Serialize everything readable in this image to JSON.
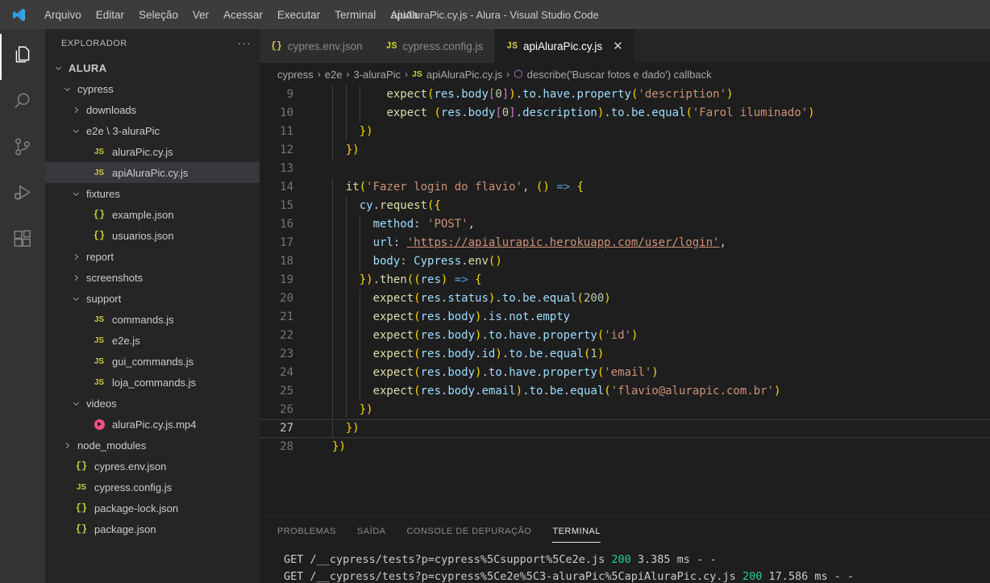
{
  "window": {
    "title": "apiAluraPic.cy.js - Alura - Visual Studio Code",
    "logo_icon": "vscode-logo-icon"
  },
  "menu": {
    "items": [
      {
        "label": "Arquivo"
      },
      {
        "label": "Editar"
      },
      {
        "label": "Seleção"
      },
      {
        "label": "Ver"
      },
      {
        "label": "Acessar"
      },
      {
        "label": "Executar"
      },
      {
        "label": "Terminal"
      },
      {
        "label": "Ajuda"
      }
    ]
  },
  "activitybar": {
    "items": [
      {
        "name": "explorer",
        "icon": "files-icon",
        "active": true
      },
      {
        "name": "search",
        "icon": "search-icon",
        "active": false
      },
      {
        "name": "source-control",
        "icon": "source-control-icon",
        "active": false
      },
      {
        "name": "run-and-debug",
        "icon": "run-debug-icon",
        "active": false
      },
      {
        "name": "extensions",
        "icon": "extensions-icon",
        "active": false
      }
    ]
  },
  "sidebar": {
    "header": {
      "title": "EXPLORADOR",
      "more_icon": "ellipsis-icon"
    },
    "items": [
      {
        "label": "ALURA",
        "kind": "root",
        "indent": 0,
        "expanded": true,
        "selected": false
      },
      {
        "label": "cypress",
        "kind": "folder",
        "indent": 1,
        "expanded": true,
        "selected": false
      },
      {
        "label": "downloads",
        "kind": "folder",
        "indent": 2,
        "expanded": false,
        "selected": false
      },
      {
        "label": "e2e \\ 3-aluraPic",
        "kind": "folder",
        "indent": 2,
        "expanded": true,
        "selected": false
      },
      {
        "label": "aluraPic.cy.js",
        "kind": "js",
        "indent": 3,
        "selected": false
      },
      {
        "label": "apiAluraPic.cy.js",
        "kind": "js",
        "indent": 3,
        "selected": true
      },
      {
        "label": "fixtures",
        "kind": "folder",
        "indent": 2,
        "expanded": true,
        "selected": false
      },
      {
        "label": "example.json",
        "kind": "json",
        "indent": 3,
        "selected": false
      },
      {
        "label": "usuarios.json",
        "kind": "json",
        "indent": 3,
        "selected": false
      },
      {
        "label": "report",
        "kind": "folder",
        "indent": 2,
        "expanded": false,
        "selected": false
      },
      {
        "label": "screenshots",
        "kind": "folder",
        "indent": 2,
        "expanded": false,
        "selected": false
      },
      {
        "label": "support",
        "kind": "folder",
        "indent": 2,
        "expanded": true,
        "selected": false
      },
      {
        "label": "commands.js",
        "kind": "js",
        "indent": 3,
        "selected": false
      },
      {
        "label": "e2e.js",
        "kind": "js",
        "indent": 3,
        "selected": false
      },
      {
        "label": "gui_commands.js",
        "kind": "js",
        "indent": 3,
        "selected": false
      },
      {
        "label": "loja_commands.js",
        "kind": "js",
        "indent": 3,
        "selected": false
      },
      {
        "label": "videos",
        "kind": "folder",
        "indent": 2,
        "expanded": true,
        "selected": false
      },
      {
        "label": "aluraPic.cy.js.mp4",
        "kind": "mp4",
        "indent": 3,
        "selected": false
      },
      {
        "label": "node_modules",
        "kind": "folder",
        "indent": 1,
        "expanded": false,
        "selected": false
      },
      {
        "label": "cypres.env.json",
        "kind": "json",
        "indent": 1,
        "selected": false
      },
      {
        "label": "cypress.config.js",
        "kind": "js",
        "indent": 1,
        "selected": false
      },
      {
        "label": "package-lock.json",
        "kind": "json",
        "indent": 1,
        "selected": false
      },
      {
        "label": "package.json",
        "kind": "json",
        "indent": 1,
        "selected": false
      }
    ]
  },
  "tabs": [
    {
      "label": "cypres.env.json",
      "icon": "json-file-icon",
      "icon_glyph": "{}",
      "active": false,
      "closeable": false
    },
    {
      "label": "cypress.config.js",
      "icon": "js-file-icon",
      "icon_glyph": "JS",
      "active": false,
      "closeable": false
    },
    {
      "label": "apiAluraPic.cy.js",
      "icon": "js-file-icon",
      "icon_glyph": "JS",
      "active": true,
      "closeable": true,
      "close_glyph": "✕"
    }
  ],
  "breadcrumb": {
    "segments": [
      "cypress",
      "e2e",
      "3-aluraPic",
      "apiAluraPic.cy.js",
      "describe('Buscar fotos e dado') callback"
    ],
    "separator": "›",
    "js_glyph": "JS",
    "symbol_glyph": "⬡"
  },
  "editor": {
    "current_line": 27,
    "lines": [
      {
        "n": 9,
        "indent_guides": [
          1,
          2,
          3
        ]
      },
      {
        "n": 10,
        "indent_guides": [
          1,
          2,
          3
        ]
      },
      {
        "n": 11,
        "indent_guides": [
          1,
          2
        ]
      },
      {
        "n": 12,
        "indent_guides": [
          1
        ]
      },
      {
        "n": 13,
        "indent_guides": [
          1
        ]
      },
      {
        "n": 14,
        "indent_guides": [
          1
        ]
      },
      {
        "n": 15,
        "indent_guides": [
          1,
          2
        ]
      },
      {
        "n": 16,
        "indent_guides": [
          1,
          2,
          3
        ]
      },
      {
        "n": 17,
        "indent_guides": [
          1,
          2,
          3
        ]
      },
      {
        "n": 18,
        "indent_guides": [
          1,
          2,
          3
        ]
      },
      {
        "n": 19,
        "indent_guides": [
          1,
          2
        ]
      },
      {
        "n": 20,
        "indent_guides": [
          1,
          2,
          3
        ]
      },
      {
        "n": 21,
        "indent_guides": [
          1,
          2,
          3
        ]
      },
      {
        "n": 22,
        "indent_guides": [
          1,
          2,
          3
        ]
      },
      {
        "n": 23,
        "indent_guides": [
          1,
          2,
          3
        ]
      },
      {
        "n": 24,
        "indent_guides": [
          1,
          2,
          3
        ]
      },
      {
        "n": 25,
        "indent_guides": [
          1,
          2,
          3
        ]
      },
      {
        "n": 26,
        "indent_guides": [
          1,
          2
        ]
      },
      {
        "n": 27,
        "indent_guides": [
          1
        ]
      },
      {
        "n": 28,
        "indent_guides": []
      }
    ],
    "source_text": [
      "        expect(res.body[0]).to.have.property('description')",
      "        expect (res.body[0].description).to.be.equal('Farol iluminado')",
      "    })",
      "  })",
      "",
      "  it('Fazer login do flavio', () => {",
      "    cy.request({",
      "      method: 'POST',",
      "      url: 'https://apialurapic.herokuapp.com/user/login',",
      "      body: Cypress.env()",
      "    }).then((res) => {",
      "      expect(res.status).to.be.equal(200)",
      "      expect(res.body).is.not.empty",
      "      expect(res.body).to.have.property('id')",
      "      expect(res.body.id).to.be.equal(1)",
      "      expect(res.body).to.have.property('email')",
      "      expect(res.body.email).to.be.equal('flavio@alurapic.com.br')",
      "    })",
      "  })",
      "})"
    ]
  },
  "panel": {
    "tabs": [
      {
        "label": "PROBLEMAS",
        "active": false
      },
      {
        "label": "SAÍDA",
        "active": false
      },
      {
        "label": "CONSOLE DE DEPURAÇÃO",
        "active": false
      },
      {
        "label": "TERMINAL",
        "active": true
      }
    ],
    "terminal_lines": [
      {
        "pre": "GET /__cypress/tests?p=cypress%5Csupport%5Ce2e.js ",
        "status": "200",
        "post": " 3.385 ms - -"
      },
      {
        "pre": "GET /__cypress/tests?p=cypress%5Ce2e%5C3-aluraPic%5CapiAluraPic.cy.js ",
        "status": "200",
        "post": " 17.586 ms - -"
      }
    ]
  },
  "colors": {
    "titlebar_bg": "#3c3c3c",
    "activitybar_bg": "#333333",
    "sidebar_bg": "#252526",
    "editor_bg": "#1e1e1e",
    "selection_bg": "#37373d",
    "accent_js": "#cbcb41",
    "string": "#ce9178",
    "function": "#dcdcaa",
    "variable": "#9cdcfe",
    "number": "#b5cea8",
    "terminal_ok": "#23d18b"
  }
}
